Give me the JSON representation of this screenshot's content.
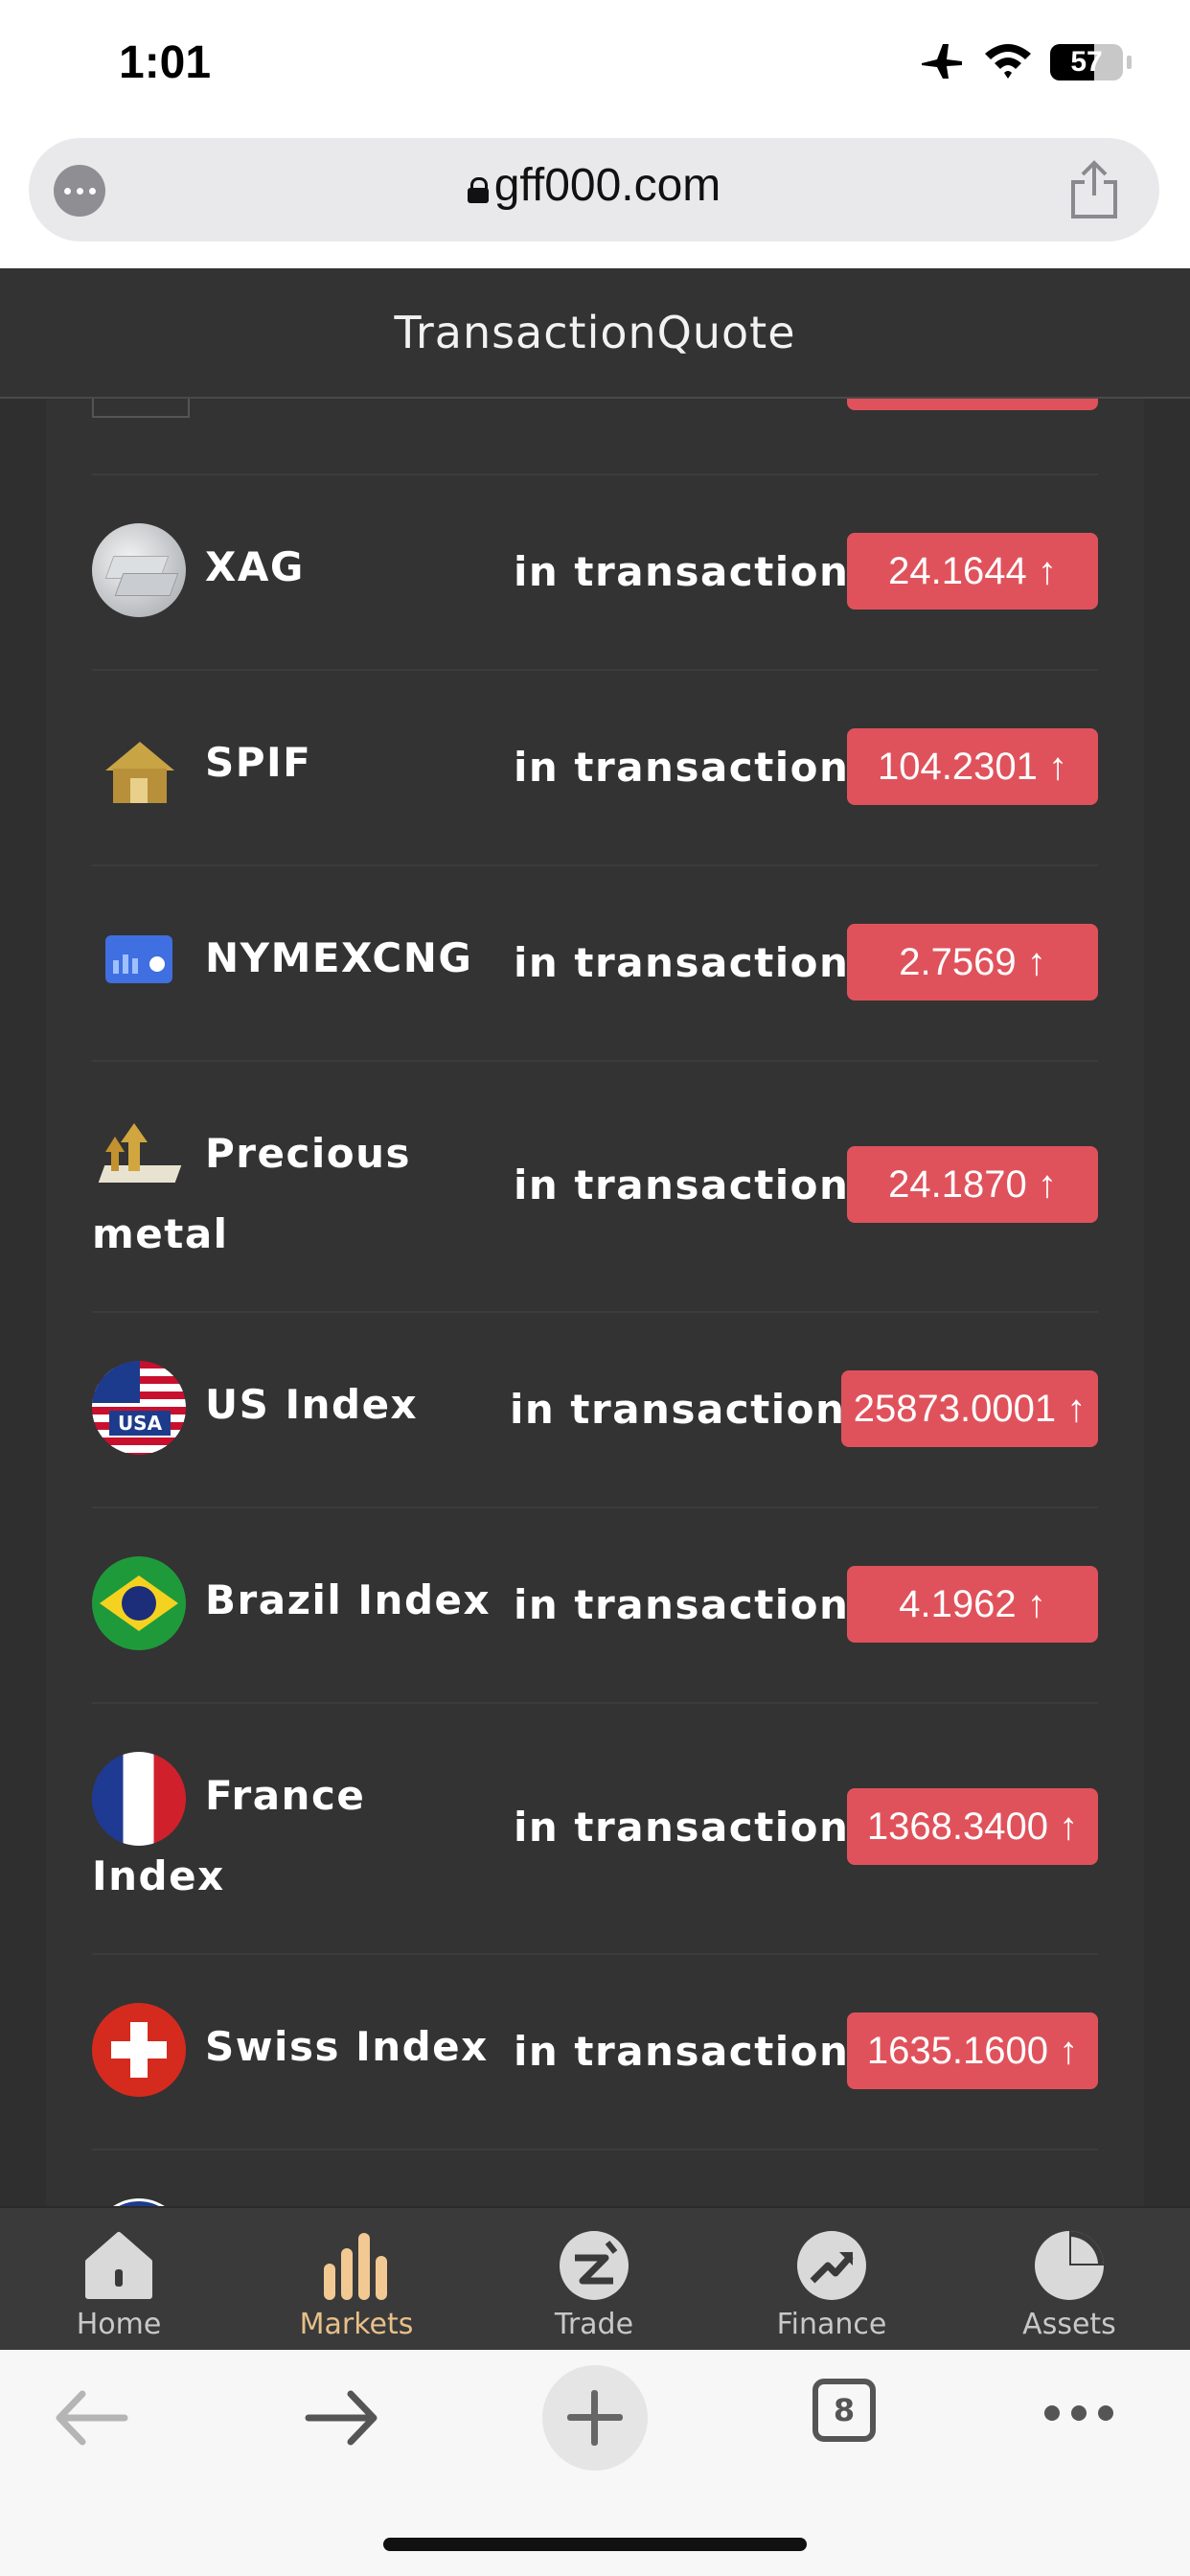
{
  "status_bar": {
    "time": "1:01",
    "battery": "57"
  },
  "browser": {
    "url": "gff000.com",
    "tabs_count": "8"
  },
  "page": {
    "title": "TransactionQuote",
    "rows": [
      {
        "name": "XAG",
        "status": "in transaction",
        "price": "24.1644",
        "arrow": "↑",
        "icon": "silver-bars-icon"
      },
      {
        "name": "SPIF",
        "status": "in transaction",
        "price": "104.2301",
        "arrow": "↑",
        "icon": "gold-house-icon"
      },
      {
        "name": "NYMEXCNG",
        "status": "in transaction",
        "price": "2.7569",
        "arrow": "↑",
        "icon": "blue-screen-icon"
      },
      {
        "name": "Precious metal",
        "status": "in transaction",
        "price": "24.1870",
        "arrow": "↑",
        "icon": "gold-arrows-icon"
      },
      {
        "name": "US Index",
        "status": "in transaction",
        "price": "25873.0001",
        "arrow": "↑",
        "icon": "usa-flag-icon"
      },
      {
        "name": "Brazil Index",
        "status": "in transaction",
        "price": "4.1962",
        "arrow": "↑",
        "icon": "brazil-flag-icon"
      },
      {
        "name": "France Index",
        "status": "in transaction",
        "price": "1368.3400",
        "arrow": "↑",
        "icon": "france-flag-icon"
      },
      {
        "name": "Swiss Index",
        "status": "in transaction",
        "price": "1635.1600",
        "arrow": "↑",
        "icon": "swiss-flag-icon"
      }
    ]
  },
  "tabbar": {
    "items": [
      {
        "label": "Home",
        "icon": "home-icon",
        "active": false
      },
      {
        "label": "Markets",
        "icon": "markets-icon",
        "active": true
      },
      {
        "label": "Trade",
        "icon": "trade-icon",
        "active": false
      },
      {
        "label": "Finance",
        "icon": "finance-icon",
        "active": false
      },
      {
        "label": "Assets",
        "icon": "assets-icon",
        "active": false
      }
    ]
  },
  "colors": {
    "accent": "#e7c089",
    "price_bg": "#e0525b",
    "page_bg": "#333333"
  }
}
